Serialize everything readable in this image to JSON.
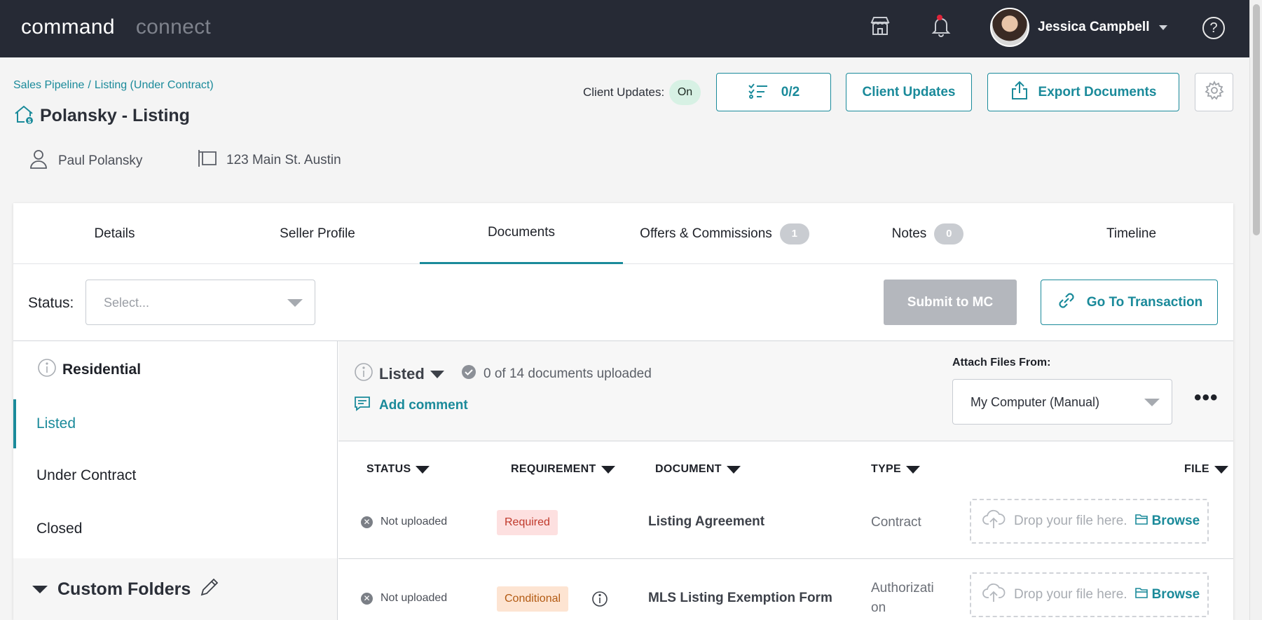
{
  "topbar": {
    "brand_primary": "command",
    "brand_secondary": "connect",
    "store_icon": "storefront-icon",
    "bell_icon": "bell-icon",
    "user_name": "Jessica Campbell",
    "help_label": "?"
  },
  "header": {
    "breadcrumb": [
      "Sales Pipeline",
      "Listing (Under Contract)"
    ],
    "breadcrumb_sep": "/",
    "title": "Polansky - Listing",
    "client_name": "Paul Polansky",
    "address": "123 Main St. Austin",
    "client_updates_label": "Client Updates:",
    "client_updates_state": "On",
    "tasks_count": "0/2",
    "client_updates_button": "Client Updates",
    "export_button": "Export Documents"
  },
  "tabs": [
    {
      "label": "Details"
    },
    {
      "label": "Seller Profile"
    },
    {
      "label": "Documents"
    },
    {
      "label": "Offers & Commissions",
      "badge": "1"
    },
    {
      "label": "Notes",
      "badge": "0"
    },
    {
      "label": "Timeline"
    }
  ],
  "status_bar": {
    "label": "Status:",
    "placeholder": "Select...",
    "submit_button": "Submit to MC",
    "goto_button": "Go To Transaction"
  },
  "sidebar": {
    "heading": "Residential",
    "items": [
      "Listed",
      "Under Contract",
      "Closed"
    ],
    "custom_folders": "Custom Folders"
  },
  "main": {
    "stage": "Listed",
    "uploaded_text": "0 of 14 documents uploaded",
    "add_comment": "Add comment",
    "attach_label": "Attach Files From:",
    "attach_value": "My Computer (Manual)",
    "columns": [
      "STATUS",
      "REQUIREMENT",
      "DOCUMENT",
      "TYPE",
      "FILE"
    ],
    "rows": [
      {
        "status": "Not uploaded",
        "requirement": "Required",
        "document": "Listing Agreement",
        "type": "Contract",
        "drop": "Drop your file here.",
        "browse": "Browse"
      },
      {
        "status": "Not uploaded",
        "requirement": "Conditional",
        "document": "MLS Listing Exemption Form",
        "type_line1": "Authorizati",
        "type_line2": "on",
        "drop": "Drop your file here.",
        "browse": "Browse"
      }
    ]
  },
  "colors": {
    "accent": "#1a8a9a",
    "topbar": "#262a35",
    "required": "#c0392b",
    "conditional": "#b35a12"
  }
}
